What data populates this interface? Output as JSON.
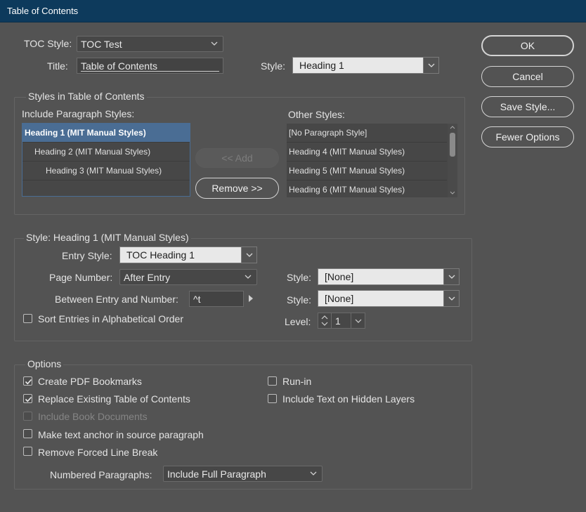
{
  "window": {
    "title": "Table of Contents"
  },
  "toc_style": {
    "label": "TOC Style:",
    "value": "TOC Test"
  },
  "title_field": {
    "label": "Title:",
    "value": "Table of Contents"
  },
  "title_style": {
    "label": "Style:",
    "value": "Heading 1"
  },
  "buttons": {
    "ok": "OK",
    "cancel": "Cancel",
    "save_style": "Save Style...",
    "fewer_options": "Fewer Options"
  },
  "styles_group": {
    "title": "Styles in Table of Contents",
    "include_label": "Include Paragraph Styles:",
    "include_items": [
      "Heading 1 (MIT Manual Styles)",
      "Heading 2 (MIT Manual Styles)",
      "Heading 3 (MIT Manual Styles)"
    ],
    "add_button": "<< Add",
    "remove_button": "Remove >>",
    "other_label": "Other Styles:",
    "other_items": [
      "[No Paragraph Style]",
      "Heading 4 (MIT Manual Styles)",
      "Heading 5 (MIT Manual Styles)",
      "Heading 6 (MIT Manual Styles)"
    ]
  },
  "style_group": {
    "title": "Style: Heading 1 (MIT Manual Styles)",
    "entry_style_label": "Entry Style:",
    "entry_style_value": "TOC Heading 1",
    "page_number_label": "Page Number:",
    "page_number_value": "After Entry",
    "page_number_style_label": "Style:",
    "page_number_style_value": "[None]",
    "between_label": "Between Entry and Number:",
    "between_value": "^t",
    "between_style_label": "Style:",
    "between_style_value": "[None]",
    "sort_label": "Sort Entries in Alphabetical Order",
    "level_label": "Level:",
    "level_value": "1"
  },
  "options_group": {
    "title": "Options",
    "create_pdf": "Create PDF Bookmarks",
    "replace_existing": "Replace Existing Table of Contents",
    "include_book": "Include Book Documents",
    "make_anchor": "Make text anchor in source paragraph",
    "remove_forced": "Remove Forced Line Break",
    "run_in": "Run-in",
    "include_hidden": "Include Text on Hidden Layers",
    "numbered_label": "Numbered Paragraphs:",
    "numbered_value": "Include Full Paragraph"
  },
  "colors": {
    "background": "#535353",
    "titlebar": "#0d3a5c",
    "selection": "#4a6d94"
  }
}
